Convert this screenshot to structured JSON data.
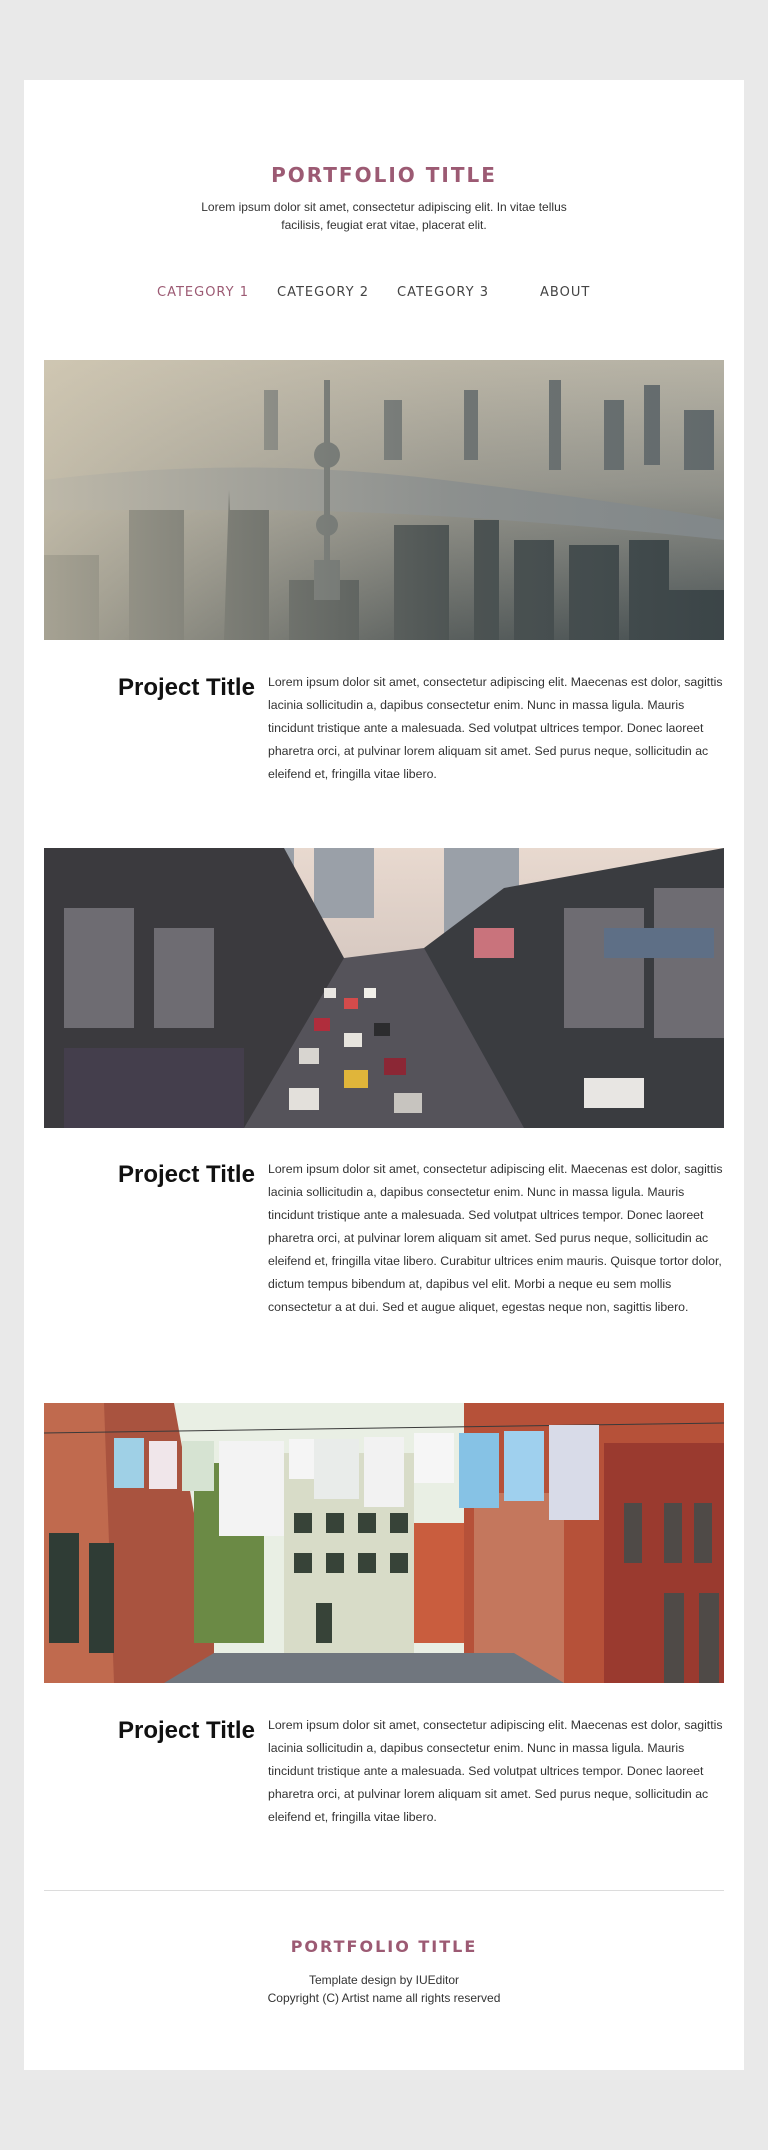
{
  "header": {
    "title": "PORTFOLIO TITLE",
    "tagline": "Lorem ipsum dolor sit amet, consectetur adipiscing elit. In vitae tellus facilisis, feugiat erat vitae, placerat elit."
  },
  "nav": {
    "items": [
      {
        "label": "CATEGORY 1",
        "active": true
      },
      {
        "label": "CATEGORY 2",
        "active": false
      },
      {
        "label": "CATEGORY 3",
        "active": false
      },
      {
        "label": "ABOUT",
        "active": false
      }
    ]
  },
  "projects": [
    {
      "title": "Project Title",
      "image": "city-skyline-photo",
      "text": "Lorem ipsum dolor sit amet, consectetur adipiscing elit. Maecenas est dolor, sagittis lacinia sollicitudin a, dapibus consectetur enim. Nunc in massa ligula. Mauris tincidunt tristique ante a malesuada. Sed volutpat ultrices tempor. Donec laoreet pharetra orci, at pulvinar lorem aliquam sit amet. Sed purus neque, sollicitudin ac eleifend et, fringilla vitae libero."
    },
    {
      "title": "Project Title",
      "image": "street-traffic-photo",
      "text": "Lorem ipsum dolor sit amet, consectetur adipiscing elit. Maecenas est dolor, sagittis lacinia sollicitudin a, dapibus consectetur enim. Nunc in massa ligula. Mauris tincidunt tristique ante a malesuada. Sed volutpat ultrices tempor. Donec laoreet pharetra orci, at pulvinar lorem aliquam sit amet. Sed purus neque, sollicitudin ac eleifend et, fringilla vitae libero. Curabitur ultrices enim mauris. Quisque tortor dolor, dictum tempus bibendum at, dapibus vel elit. Morbi a neque eu sem mollis consectetur a at dui. Sed et augue aliquet, egestas neque non, sagittis libero."
    },
    {
      "title": "Project Title",
      "image": "laundry-alley-photo",
      "text": "Lorem ipsum dolor sit amet, consectetur adipiscing elit. Maecenas est dolor, sagittis lacinia sollicitudin a, dapibus consectetur enim. Nunc in massa ligula. Mauris tincidunt tristique ante a malesuada. Sed volutpat ultrices tempor. Donec laoreet pharetra orci, at pulvinar lorem aliquam sit amet. Sed purus neque, sollicitudin ac eleifend et, fringilla vitae libero."
    }
  ],
  "footer": {
    "title": "PORTFOLIO TITLE",
    "credit": "Template design by IUEditor",
    "copyright": "Copyright (C) Artist name all rights reserved"
  },
  "colors": {
    "accent": "#9c5a73",
    "background": "#e9e9e9",
    "page": "#ffffff",
    "text": "#333333"
  }
}
